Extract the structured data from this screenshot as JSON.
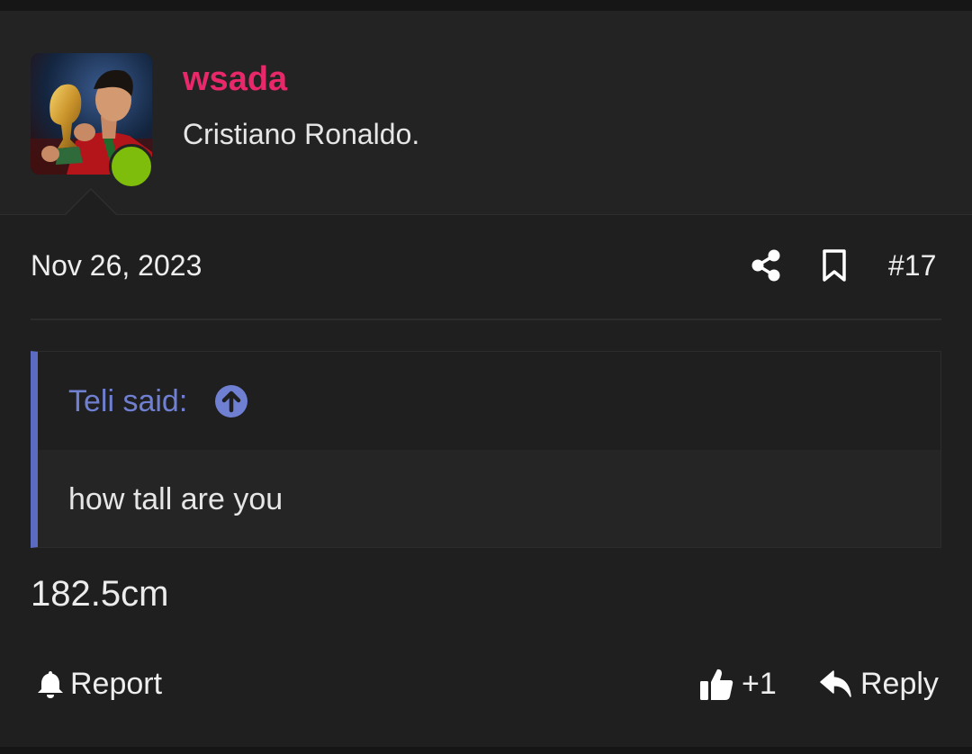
{
  "user": {
    "name": "wsada",
    "title": "Cristiano Ronaldo.",
    "online": true,
    "avatar_icon": "avatar-image",
    "name_color": "#e8286a",
    "online_color": "#7ebd0b"
  },
  "post": {
    "date": "Nov 26, 2023",
    "number": "#17",
    "share_icon": "share-icon",
    "bookmark_icon": "bookmark-icon"
  },
  "quote": {
    "author_label": "Teli said:",
    "text": "how tall are you",
    "accent_color": "#5b6bc2",
    "jump_icon": "arrow-up-circle-icon"
  },
  "message": {
    "text": "182.5cm"
  },
  "actions": {
    "report_label": "Report",
    "like_count": "+1",
    "reply_label": "Reply"
  }
}
